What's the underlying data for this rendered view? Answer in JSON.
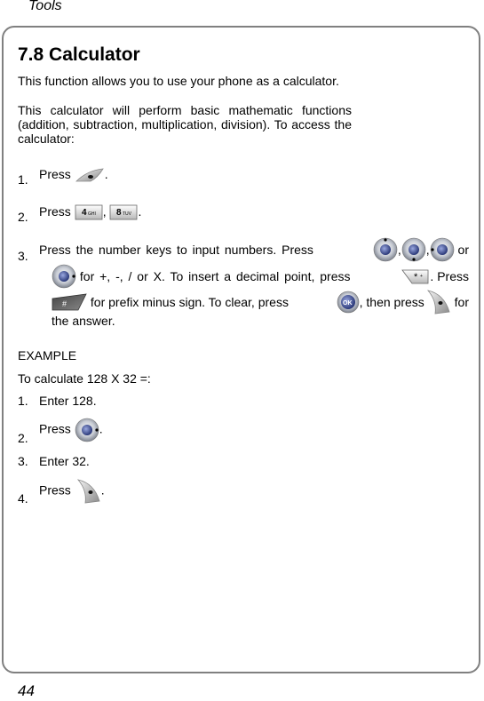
{
  "header": {
    "section": "Tools"
  },
  "title": "7.8 Calculator",
  "intro": "This function allows you to use your phone as a calculator.",
  "description": "This calculator will perform basic mathematic functions (addition, subtraction, multiplication, division). To access the calculator:",
  "steps": [
    {
      "num": "1.",
      "text": "Press",
      "suffix": "."
    },
    {
      "num": "2.",
      "text": "Press",
      "sep": ",",
      "suffix": ".",
      "keys": [
        "4GHI",
        "8TUV"
      ]
    },
    {
      "num": "3.",
      "text_a": "Press the number keys to input numbers. Press",
      "sep1": ",",
      "sep2": ",",
      "or": "or",
      "text_b": "for +, -, / or X. To insert a decimal point, press",
      "text_c": ". Press",
      "text_d": "for prefix minus sign. To clear, press",
      "text_e": ", then press",
      "text_f": "for",
      "text_g": "the answer."
    }
  ],
  "example": {
    "heading": "EXAMPLE",
    "task": "To calculate 128 X 32 =:",
    "steps": [
      {
        "num": "1.",
        "text": "Enter 128."
      },
      {
        "num": "2.",
        "text": "Press",
        "suffix": "."
      },
      {
        "num": "3.",
        "text": "Enter 32."
      },
      {
        "num": "4.",
        "text": "Press",
        "suffix": "."
      }
    ]
  },
  "footer": {
    "page_number": "44"
  }
}
